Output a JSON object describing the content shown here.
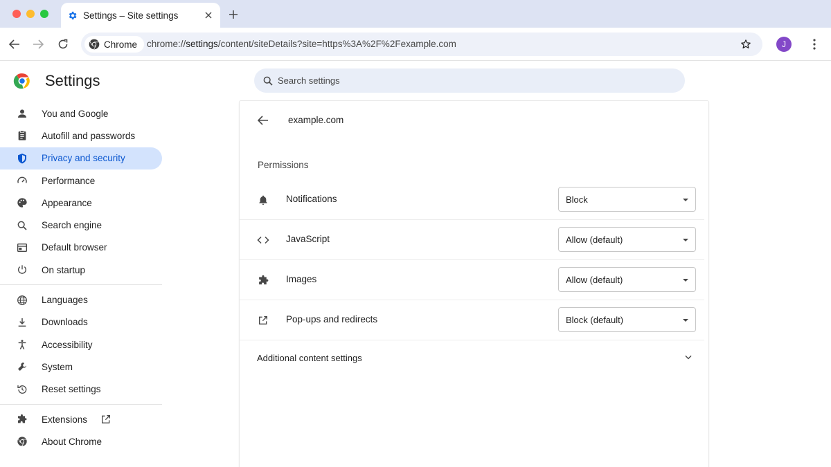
{
  "window": {
    "tab_title": "Settings – Site settings",
    "chip_label": "Chrome",
    "url_prefix": "chrome://",
    "url_highlight": "settings",
    "url_rest": "/content/siteDetails?site=https%3A%2F%2Fexample.com",
    "avatar_initial": "J"
  },
  "settings": {
    "title": "Settings",
    "search_placeholder": "Search settings"
  },
  "sidebar": {
    "items": [
      {
        "label": "You and Google",
        "icon": "person-icon"
      },
      {
        "label": "Autofill and passwords",
        "icon": "clipboard-icon"
      },
      {
        "label": "Privacy and security",
        "icon": "shield-icon",
        "active": true
      },
      {
        "label": "Performance",
        "icon": "speedometer-icon"
      },
      {
        "label": "Appearance",
        "icon": "palette-icon"
      },
      {
        "label": "Search engine",
        "icon": "search-icon"
      },
      {
        "label": "Default browser",
        "icon": "browser-icon"
      },
      {
        "label": "On startup",
        "icon": "power-icon"
      },
      {
        "label": "Languages",
        "icon": "globe-icon"
      },
      {
        "label": "Downloads",
        "icon": "download-icon"
      },
      {
        "label": "Accessibility",
        "icon": "accessibility-icon"
      },
      {
        "label": "System",
        "icon": "wrench-icon"
      },
      {
        "label": "Reset settings",
        "icon": "history-icon"
      },
      {
        "label": "Extensions",
        "icon": "puzzle-icon"
      },
      {
        "label": "About Chrome",
        "icon": "chrome-icon"
      }
    ]
  },
  "site": {
    "name": "example.com",
    "permissions_heading": "Permissions",
    "permissions": [
      {
        "label": "Notifications",
        "value": "Block",
        "icon": "bell-icon"
      },
      {
        "label": "JavaScript",
        "value": "Allow (default)",
        "icon": "code-icon"
      },
      {
        "label": "Images",
        "value": "Allow (default)",
        "icon": "puzzle-icon"
      },
      {
        "label": "Pop-ups and redirects",
        "value": "Block (default)",
        "icon": "open-in-new-icon"
      }
    ],
    "additional_label": "Additional content settings"
  },
  "colors": {
    "accent": "#0b57d0",
    "active_bg": "#d3e3fd",
    "tabstrip_bg": "#dde3f3",
    "avatar_bg": "#8348c8"
  }
}
